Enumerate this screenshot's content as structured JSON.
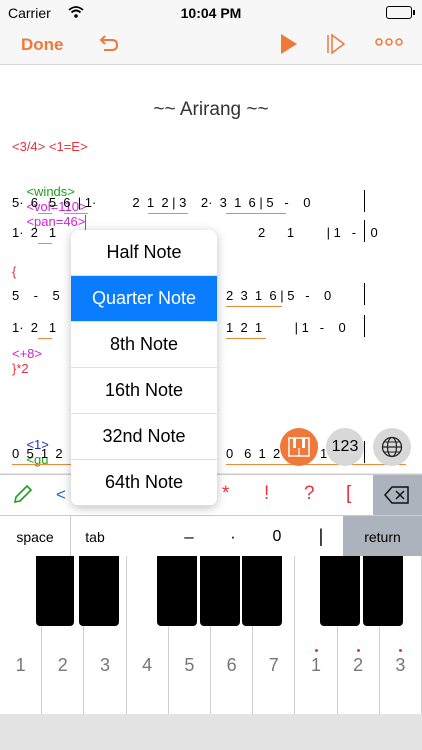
{
  "status": {
    "carrier": "Carrier",
    "time": "10:04 PM"
  },
  "toolbar": {
    "done": "Done",
    "undo_icon": "undo-icon",
    "play_icon": "play-icon",
    "step_icon": "step-play-icon",
    "more_icon": "more-icon"
  },
  "score": {
    "title": "~~ Arirang ~~",
    "time_key": "<3/4> <1=E>",
    "instrument": "<winds>",
    "vol": "<vol=110>",
    "pan": "<pan=46>",
    "row1": "5·  6   5  6  | 1·          2  1  2 | 3    2·  3  1  6 | 5   -    0",
    "row2": "1·  2   1",
    "row2b": "2      1         | 1   -    0",
    "brace": "{",
    "row3a": "5    -    5",
    "row3b": "2  3  1  6 | 5   -    0",
    "row4a": "1·  2   1",
    "row4b": "1  2  1         | 1   -    0",
    "repeat": "<+8>",
    "repeat_end": "}*2",
    "tag1": "<1>",
    "tag2": "<gu",
    "row5": "0  5  1  2",
    "row5b": "0   6  1  2  3   0  1  2  3"
  },
  "popup": {
    "items": [
      "Half Note",
      "Quarter Note",
      "8th Note",
      "16th Note",
      "32nd Note",
      "64th Note"
    ],
    "selected": 1
  },
  "floating": {
    "piano_btn_icon": "piano-icon",
    "numpad_label": "123",
    "globe_icon": "globe-icon"
  },
  "keys_row1": {
    "pencil_icon": "pencil-icon",
    "lt": "<",
    "star": "*",
    "excl": "!",
    "question": "?",
    "bracket": "[",
    "delete_icon": "delete-icon"
  },
  "keys_row2": {
    "space": "space",
    "tab": "tab",
    "dash": "–",
    "dot": "·",
    "zero": "0",
    "bar": "|",
    "return": "return"
  },
  "piano": {
    "white_labels": [
      "1",
      "2",
      "3",
      "4",
      "5",
      "6",
      "7",
      "1",
      "2",
      "3"
    ]
  },
  "colors": {
    "accent": "#f0793a",
    "red": "#e8323c",
    "green": "#1aa31a",
    "magenta": "#d323d3",
    "blue": "#1a2cd3",
    "select": "#0a7dff"
  }
}
